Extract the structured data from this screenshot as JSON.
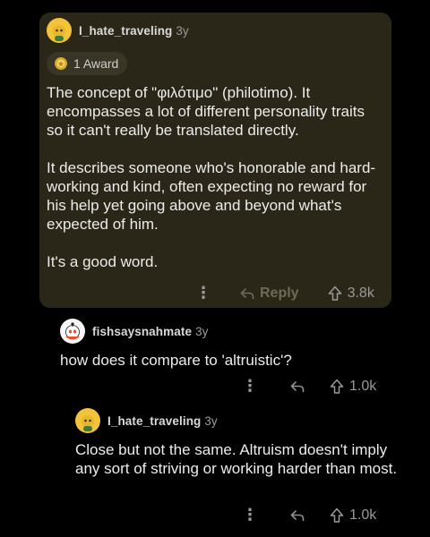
{
  "comments": [
    {
      "username": "I_hate_traveling",
      "age": "3y",
      "award": "1 Award",
      "paragraphs": [
        "The concept of \"φιλότιμο\" (philotimo). It encompasses a lot of different personality traits so it can't really be translated directly.",
        "It describes someone who's honorable and hard-working and kind, often expecting no reward for his help yet going above and beyond what's expected of him.",
        "It's a good word."
      ],
      "reply_label": "Reply",
      "votes": "3.8k"
    },
    {
      "username": "fishsaysnahmate",
      "age": "3y",
      "paragraphs": [
        "how does it compare to 'altruistic'?"
      ],
      "votes": "1.0k"
    },
    {
      "username": "I_hate_traveling",
      "age": "3y",
      "paragraphs": [
        "Close but not the same. Altruism doesn't imply any sort of striving or working harder than most."
      ],
      "votes": "1.0k"
    }
  ],
  "colors": {
    "background": "#000000",
    "highlight_card": "#2b2718",
    "avatar_yellow": "#f2c33b"
  },
  "icons": {
    "more": "more-dots-icon",
    "reply": "reply-arrow-icon",
    "upvote": "upvote-arrow-icon",
    "award": "award-badge-icon"
  }
}
